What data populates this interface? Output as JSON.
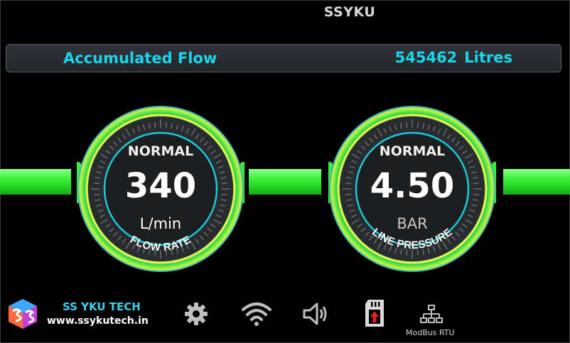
{
  "header": {
    "title": "SSYKU"
  },
  "accumulated_flow": {
    "label": "Accumulated Flow",
    "value": "545462",
    "unit": "Litres"
  },
  "gauges": [
    {
      "status": "NORMAL",
      "value": "340",
      "unit": "L/min",
      "caption": "FLOW RATE"
    },
    {
      "status": "NORMAL",
      "value": "4.50",
      "unit": "BAR",
      "caption": "LINE PRESSURE"
    }
  ],
  "footer": {
    "brand": "SS YKU TECH",
    "website": "www.ssykutech.in",
    "icons": [
      "gear-icon",
      "wifi-icon",
      "speaker-icon",
      "sd-card-upload-icon",
      "network-tree-icon"
    ],
    "modbus_label": "ModBus RTU"
  },
  "colors": {
    "accent_cyan": "#19d6ea",
    "pipe_green": "#3ff23f",
    "ring_yellow": "#e8f24a"
  }
}
